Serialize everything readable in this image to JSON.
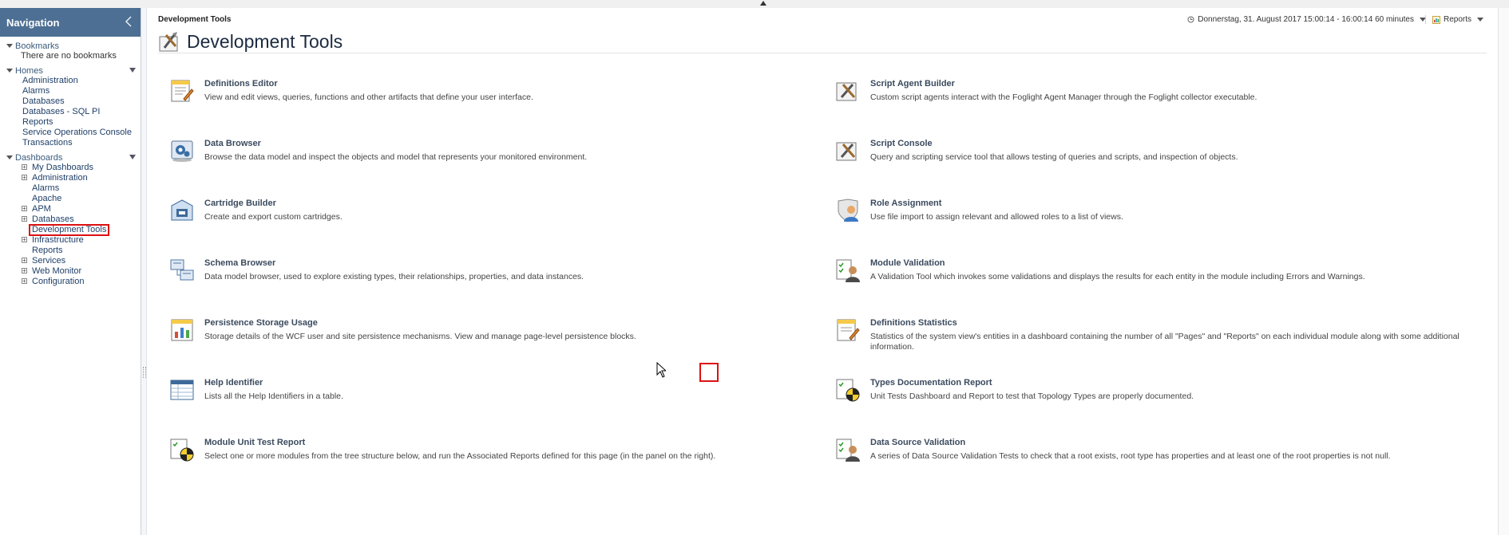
{
  "sidebar": {
    "title": "Navigation",
    "bookmarks": {
      "label": "Bookmarks",
      "empty_text": "There are no bookmarks"
    },
    "homes": {
      "label": "Homes",
      "items": [
        "Administration",
        "Alarms",
        "Databases",
        "Databases - SQL PI",
        "Reports",
        "Service Operations Console",
        "Transactions"
      ]
    },
    "dashboards": {
      "label": "Dashboards",
      "items": [
        {
          "label": "My Dashboards",
          "expandable": true
        },
        {
          "label": "Administration",
          "expandable": true
        },
        {
          "label": "Alarms",
          "expandable": false
        },
        {
          "label": "Apache",
          "expandable": false
        },
        {
          "label": "APM",
          "expandable": true
        },
        {
          "label": "Databases",
          "expandable": true
        },
        {
          "label": "Development Tools",
          "expandable": false,
          "selected": true
        },
        {
          "label": "Infrastructure",
          "expandable": true
        },
        {
          "label": "Reports",
          "expandable": false
        },
        {
          "label": "Services",
          "expandable": true
        },
        {
          "label": "Web Monitor",
          "expandable": true
        },
        {
          "label": "Configuration",
          "expandable": true
        }
      ]
    }
  },
  "header": {
    "breadcrumb": "Development Tools",
    "time_range": "Donnerstag, 31. August 2017 15:00:14 - 16:00:14 60 minutes",
    "reports_label": "Reports",
    "page_title": "Development Tools"
  },
  "tools": [
    {
      "name": "Definitions Editor",
      "desc": "View and edit views, queries, functions and other artifacts that define your user interface.",
      "icon": "definitions-editor-icon"
    },
    {
      "name": "Script Agent Builder",
      "desc": "Custom script agents interact with the Foglight Agent Manager through the Foglight collector executable.",
      "icon": "script-agent-builder-icon"
    },
    {
      "name": "Data Browser",
      "desc": "Browse the data model and inspect the objects and model that represents your monitored environment.",
      "icon": "data-browser-icon"
    },
    {
      "name": "Script Console",
      "desc": "Query and scripting service tool that allows testing of queries and scripts, and inspection of objects.",
      "icon": "script-console-icon"
    },
    {
      "name": "Cartridge Builder",
      "desc": "Create and export custom cartridges.",
      "icon": "cartridge-builder-icon"
    },
    {
      "name": "Role Assignment",
      "desc": "Use file import to assign relevant and allowed roles to a list of views.",
      "icon": "role-assignment-icon"
    },
    {
      "name": "Schema Browser",
      "desc": "Data model browser, used to explore existing types, their relationships, properties, and data instances.",
      "icon": "schema-browser-icon"
    },
    {
      "name": "Module Validation",
      "desc": "A Validation Tool which invokes some validations and displays the results for each entity in the module including Errors and Warnings.",
      "icon": "module-validation-icon"
    },
    {
      "name": "Persistence Storage Usage",
      "desc": "Storage details of the WCF user and site persistence mechanisms. View and manage page-level persistence blocks.",
      "icon": "persistence-storage-icon"
    },
    {
      "name": "Definitions Statistics",
      "desc": "Statistics of the system view's entities in a dashboard containing the number of all \"Pages\" and \"Reports\" on each individual module along with some additional information.",
      "icon": "definitions-statistics-icon"
    },
    {
      "name": "Help Identifier",
      "desc": "Lists all the Help Identifiers in a table.",
      "icon": "help-identifier-icon"
    },
    {
      "name": "Types Documentation Report",
      "desc": "Unit Tests Dashboard and Report to test that Topology Types are properly documented.",
      "icon": "types-documentation-icon"
    },
    {
      "name": "Module Unit Test Report",
      "desc": "Select one or more modules from the tree structure below, and run the Associated Reports defined for this page (in the panel on the right).",
      "icon": "module-unit-test-icon"
    },
    {
      "name": "Data Source Validation",
      "desc": "A series of Data Source Validation Tests to check that a root exists, root type has properties and at least one of the root properties is not null.",
      "icon": "data-source-validation-icon"
    }
  ],
  "colors": {
    "nav_header": "#4d6f93",
    "link": "#1f3f68",
    "highlight": "#dd1111"
  }
}
